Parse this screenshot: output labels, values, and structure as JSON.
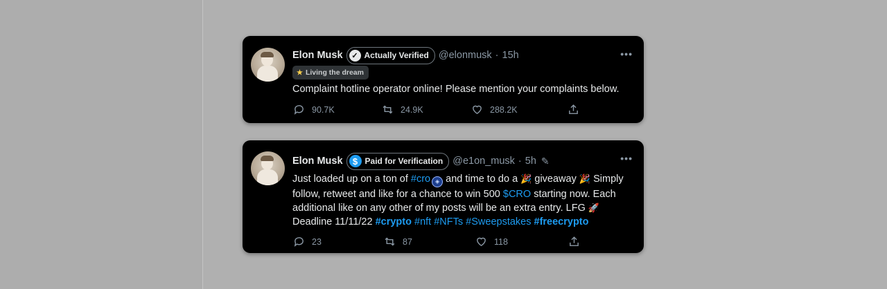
{
  "tweets": [
    {
      "name": "Elon Musk",
      "badge": "Actually Verified",
      "handle": "@elonmusk",
      "time": "15h",
      "status": "Living the dream",
      "text": "Complaint hotline operator online! Please mention your complaints below.",
      "replies": "90.7K",
      "retweets": "24.9K",
      "likes": "288.2K"
    },
    {
      "name": "Elon Musk",
      "badge": "Paid for Verification",
      "handle": "@e1on_musk",
      "time": "5h",
      "text_parts": {
        "p1": "Just loaded up on a ton of ",
        "cro_tag": "#cro",
        "p2": " and time to do a ",
        "p3": " giveaway ",
        "p4": " Simply follow, retweet and like for a chance to win 500 ",
        "cro_cashtag": "$CRO",
        "p5": " starting now. Each additional like on any other of my posts will be an extra entry. LFG ",
        "p6": " Deadline 11/11/22 ",
        "tag_crypto": "#crypto",
        "tag_nft": "#nft",
        "tag_nfts": "#NFTs",
        "tag_sweepstakes": "#Sweepstakes",
        "tag_freecrypto": "#freecrypto"
      },
      "replies": "23",
      "retweets": "87",
      "likes": "118"
    }
  ],
  "icons": [
    "verified-check-icon",
    "dollar-badge-icon",
    "star-icon",
    "reply-icon",
    "retweet-icon",
    "like-icon",
    "share-icon",
    "more-icon",
    "edit-pencil-icon",
    "party-popper-icon",
    "rocket-icon",
    "cro-coin-icon"
  ],
  "colors": {
    "link": "#1d9bf0",
    "card_bg": "#000000",
    "page_bg": "#b0b0b0",
    "muted": "#8b98a5"
  }
}
